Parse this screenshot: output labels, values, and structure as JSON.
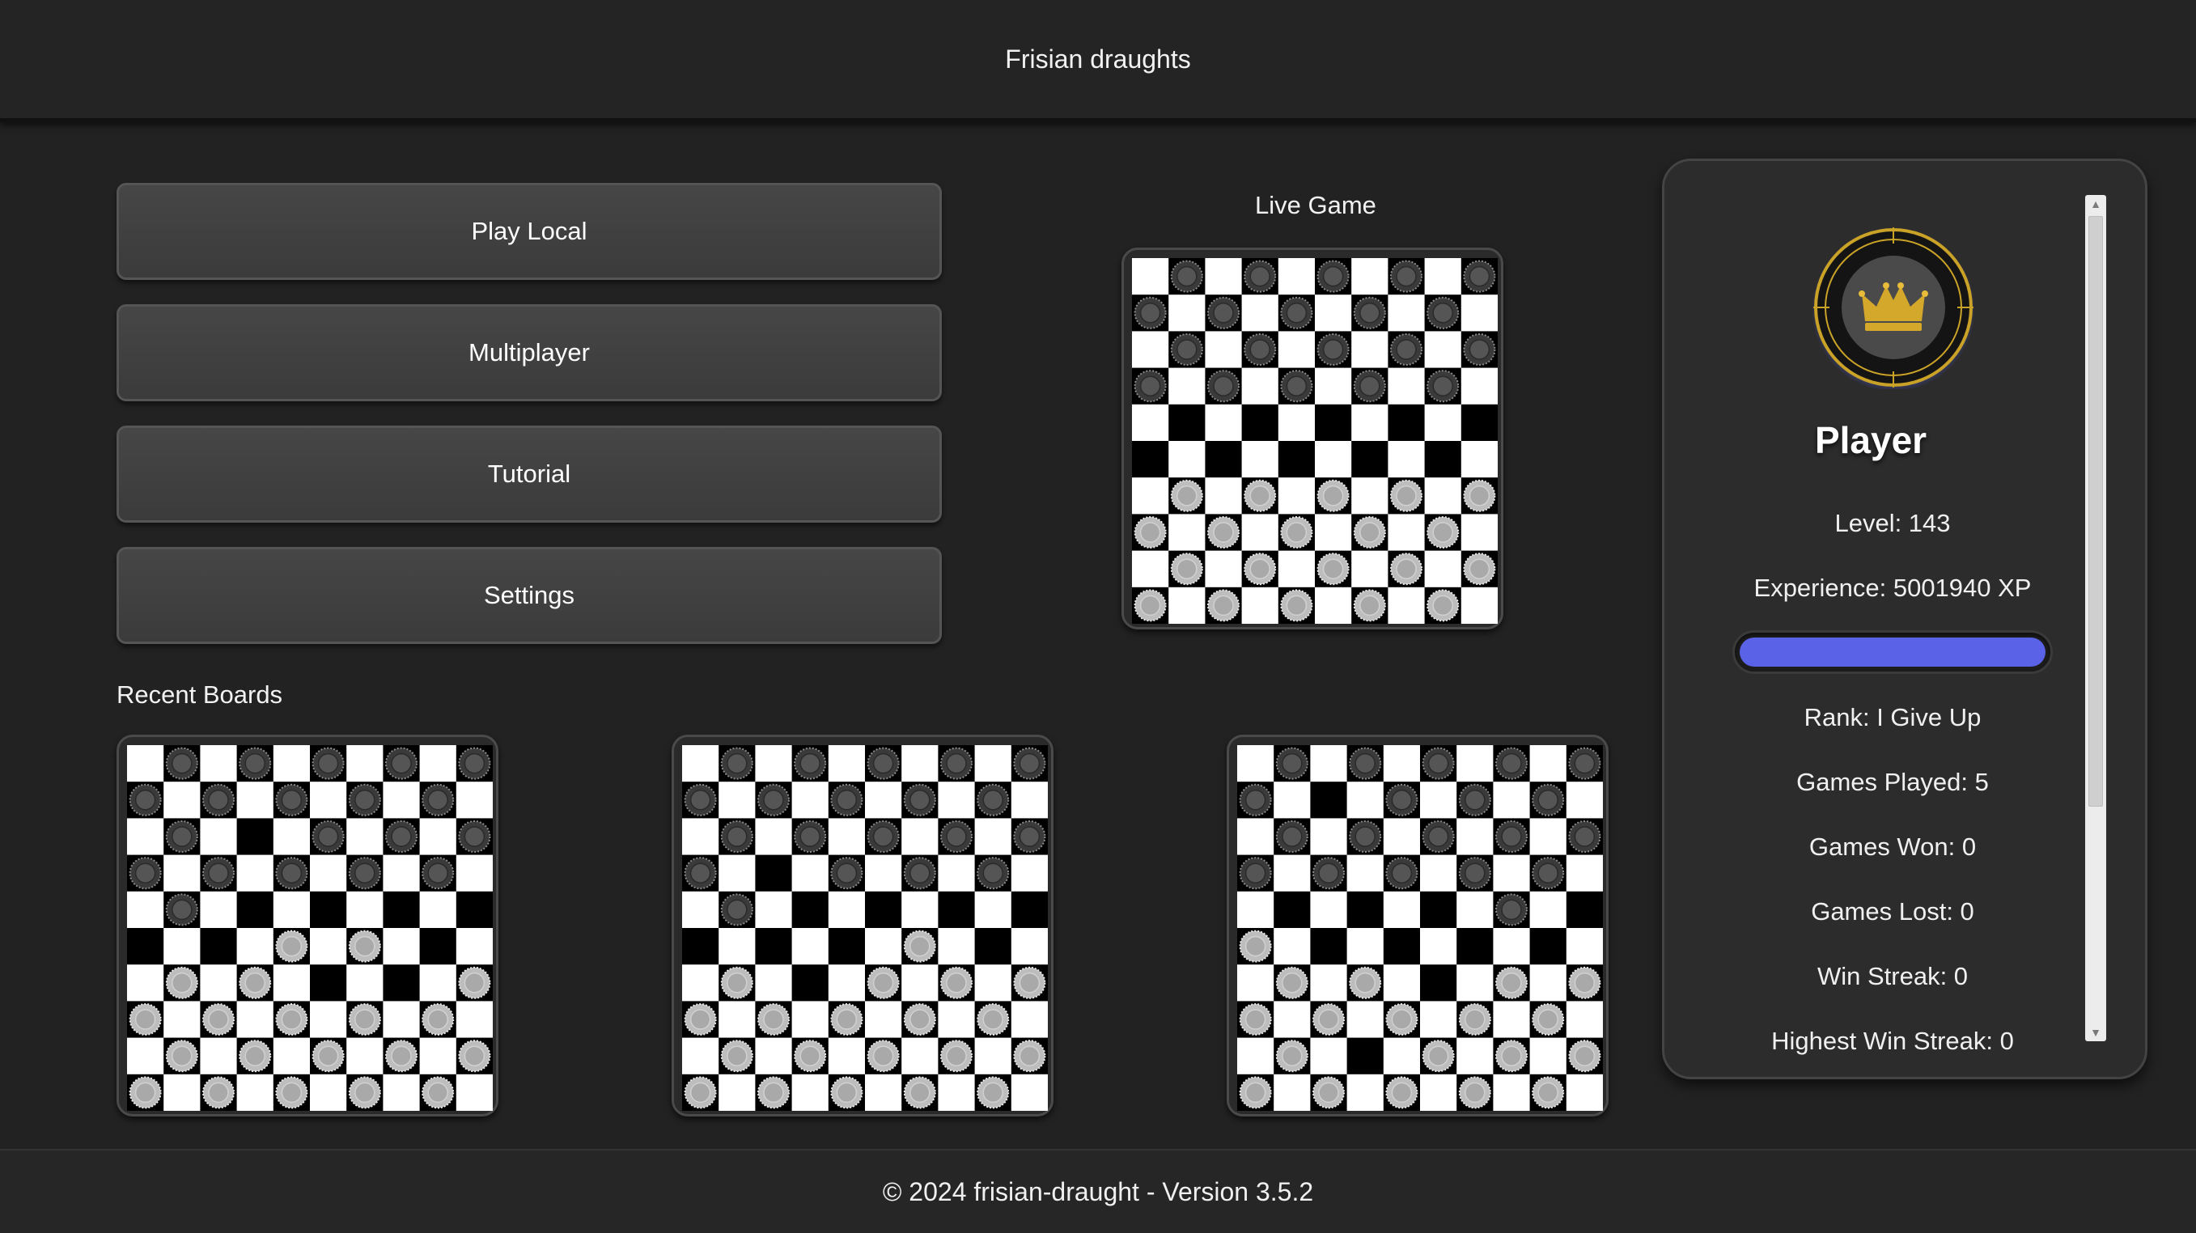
{
  "header": {
    "title": "Frisian draughts"
  },
  "menu": {
    "play_local": "Play Local",
    "multiplayer": "Multiplayer",
    "tutorial": "Tutorial",
    "settings": "Settings"
  },
  "live_game": {
    "label": "Live Game",
    "board": [
      ".b.b.b.b.b",
      "b.b.b.b.b.",
      ".b.b.b.b.b",
      "b.b.b.b.b.",
      "..........",
      "..........",
      ".w.w.w.w.w",
      "w.w.w.w.w.",
      ".w.w.w.w.w",
      "w.w.w.w.w."
    ]
  },
  "recent": {
    "label": "Recent Boards",
    "boards": [
      [
        ".b.b.b.b.b",
        "b.b.b.b.b.",
        ".b...b.b.b",
        "b.b.b.b.b.",
        ".b........",
        "....w.w...",
        ".w.w.....w",
        "w.w.w.w.w.",
        ".w.w.w.w.w",
        "w.w.w.w.w."
      ],
      [
        ".b.b.b.b.b",
        "b.b.b.b.b.",
        ".b.b.b.b.b",
        "b...b.b.b.",
        ".b........",
        "......w...",
        ".w...w.w.w",
        "w.w.w.w.w.",
        ".w.w.w.w.w",
        "w.w.w.w.w."
      ],
      [
        ".b.b.b.b.b",
        "b...b.b.b.",
        ".b.b.b.b.b",
        "b.b.b.b.b.",
        ".......b..",
        "w.........",
        ".w.w...w.w",
        "w.w.w.w.w.",
        ".w...w.w.w",
        "w.w.w.w.w."
      ]
    ]
  },
  "profile": {
    "avatar_icon": "crown-icon",
    "name": "Player",
    "level": "Level: 143",
    "experience": "Experience: 5001940 XP",
    "xp_progress": 1.0,
    "rank": "Rank: I Give Up",
    "games_played": "Games Played: 5",
    "games_won": "Games Won: 0",
    "games_lost": "Games Lost: 0",
    "win_streak": "Win Streak: 0",
    "highest_win_streak": "Highest Win Streak: 0"
  },
  "colors": {
    "accent": "#5a63e8",
    "gold": "#c9a227",
    "background": "#222222"
  },
  "footer": {
    "text": "© 2024 frisian-draught - Version 3.5.2"
  }
}
